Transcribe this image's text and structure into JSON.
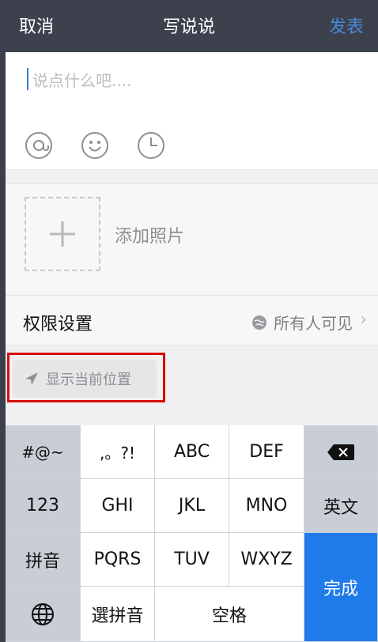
{
  "nav": {
    "left": "取消",
    "title": "写说说",
    "right": "发表",
    "accent": "#4a88d8"
  },
  "compose": {
    "placeholder": "说点什么吧....",
    "tools": [
      "at-icon",
      "emoji-icon",
      "clock-icon"
    ]
  },
  "photo": {
    "add_label": "添加照片"
  },
  "permission": {
    "label": "权限设置",
    "value": "所有人可见"
  },
  "location": {
    "label": "显示当前位置",
    "highlight_color": "#d60d0d"
  },
  "keyboard": {
    "row1": [
      "#@~",
      ",。?!",
      "ABC",
      "DEF",
      "delete-icon"
    ],
    "row2": [
      "123",
      "GHI",
      "JKL",
      "MNO",
      "英文"
    ],
    "row3": [
      "拼音",
      "PQRS",
      "TUV",
      "WXYZ"
    ],
    "row4": [
      "globe-icon",
      "選拼音",
      "空格"
    ],
    "done": "完成",
    "done_color": "#1f7bea"
  }
}
